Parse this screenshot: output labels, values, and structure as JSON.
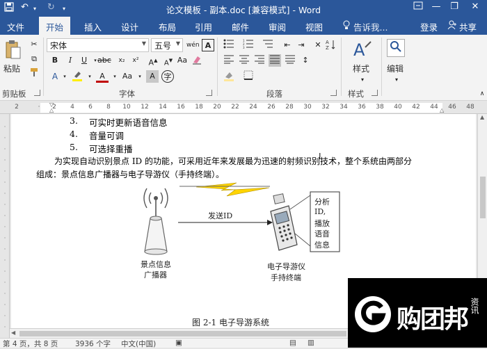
{
  "window": {
    "title": "论文模板 - 副本.doc [兼容模式] - Word"
  },
  "tabs": [
    "文件",
    "开始",
    "插入",
    "设计",
    "布局",
    "引用",
    "邮件",
    "审阅",
    "视图"
  ],
  "active_tab": "开始",
  "tell_me": "告诉我...",
  "login": "登录",
  "share": "共享",
  "ribbon": {
    "clipboard": {
      "paste": "粘贴",
      "group": "剪贴板"
    },
    "font": {
      "name": "宋体",
      "size": "五号",
      "wen": "wén",
      "group": "字体",
      "bold": "B",
      "italic": "I",
      "underline": "U",
      "aa": "Aa"
    },
    "paragraph": {
      "group": "段落"
    },
    "styles": {
      "label": "样式",
      "group": "样式"
    },
    "editing": {
      "label": "编辑"
    }
  },
  "ruler": {
    "ticks": [
      "2",
      "2",
      "4",
      "6",
      "8",
      "10",
      "12",
      "14",
      "16",
      "18",
      "20",
      "22",
      "24",
      "26",
      "28",
      "30",
      "32",
      "34",
      "36",
      "38",
      "40",
      "42",
      "44",
      "46",
      "48"
    ]
  },
  "document": {
    "list_items": [
      {
        "num": "3.",
        "text": "可实时更新语音信息"
      },
      {
        "num": "4.",
        "text": "音量可调"
      },
      {
        "num": "5.",
        "text": "可选择重播"
      }
    ],
    "para_line1": "为实现自动识别景点 ID 的功能，可采用近年来发展最为迅速的射频识别技术，整个系统由两部分",
    "para_line2": "组成：景点信息广播器与电子导游仪（手持终端）。",
    "figure": {
      "send_label": "发送ID",
      "broadcaster_label_1": "景点信息",
      "broadcaster_label_2": "广播器",
      "device_label_1": "电子导游仪",
      "device_label_2": "手持终端",
      "note_lines": [
        "分析",
        "ID,",
        "播放",
        "语音",
        "信息"
      ],
      "caption": "图 2-1   电子导游系统"
    }
  },
  "status": {
    "page": "第 4 页，共 8 页",
    "words": "3936 个字",
    "lang": "中文(中国)"
  },
  "watermark": {
    "brand": "购团邦",
    "sub": "资讯"
  }
}
